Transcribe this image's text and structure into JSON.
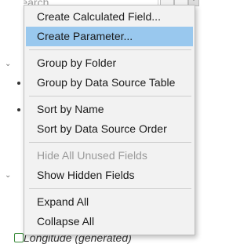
{
  "background": {
    "search_placeholder": "Search",
    "bottom_field_label": "Longitude (generated)"
  },
  "menu": {
    "items": [
      {
        "label": "Create Calculated Field...",
        "state": "normal",
        "checked": false
      },
      {
        "label": "Create Parameter...",
        "state": "hover",
        "checked": false
      },
      {
        "separator": true
      },
      {
        "label": "Group by Folder",
        "state": "normal",
        "checked": false
      },
      {
        "label": "Group by Data Source Table",
        "state": "normal",
        "checked": true
      },
      {
        "separator": true
      },
      {
        "label": "Sort by Name",
        "state": "normal",
        "checked": true
      },
      {
        "label": "Sort by Data Source Order",
        "state": "normal",
        "checked": false
      },
      {
        "separator": true
      },
      {
        "label": "Hide All Unused Fields",
        "state": "disabled",
        "checked": false
      },
      {
        "label": "Show Hidden Fields",
        "state": "normal",
        "checked": false
      },
      {
        "separator": true
      },
      {
        "label": "Expand All",
        "state": "normal",
        "checked": false
      },
      {
        "label": "Collapse All",
        "state": "normal",
        "checked": false
      }
    ]
  },
  "colors": {
    "menu_bg": "#f2f2f2",
    "hover_bg": "#99c8ee",
    "disabled_text": "#9a9a9a",
    "separator": "#cfcfcf"
  }
}
